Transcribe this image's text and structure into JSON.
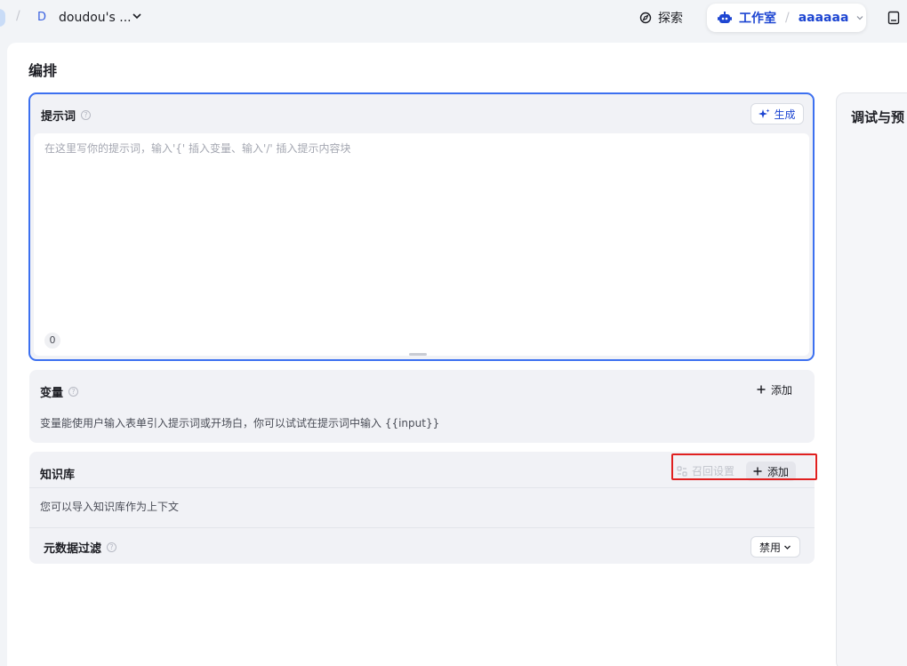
{
  "topbar": {
    "space_avatar": "D",
    "space_name": "doudou's ...",
    "explore_label": "探索",
    "studio_label": "工作室",
    "project_name": "aaaaaa"
  },
  "page": {
    "title": "编排"
  },
  "prompt": {
    "title": "提示词",
    "help": "?",
    "generate_label": "生成",
    "placeholder": "在这里写你的提示词，输入'{' 插入变量、输入'/' 插入提示内容块",
    "value": "",
    "char_count": "0"
  },
  "variables": {
    "title": "变量",
    "help": "?",
    "add_label": "添加",
    "description": "变量能使用户输入表单引入提示词或开场白，你可以试试在提示词中输入 {{input}}"
  },
  "knowledge": {
    "title": "知识库",
    "recall_label": "召回设置",
    "add_label": "添加",
    "description": "您可以导入知识库作为上下文",
    "metadata_title": "元数据过滤",
    "help": "?",
    "metadata_value": "禁用"
  },
  "debug": {
    "title": "调试与预"
  },
  "colors": {
    "accent": "#1e46d2",
    "focus_border": "#3c70f0",
    "highlight": "#e02020"
  }
}
